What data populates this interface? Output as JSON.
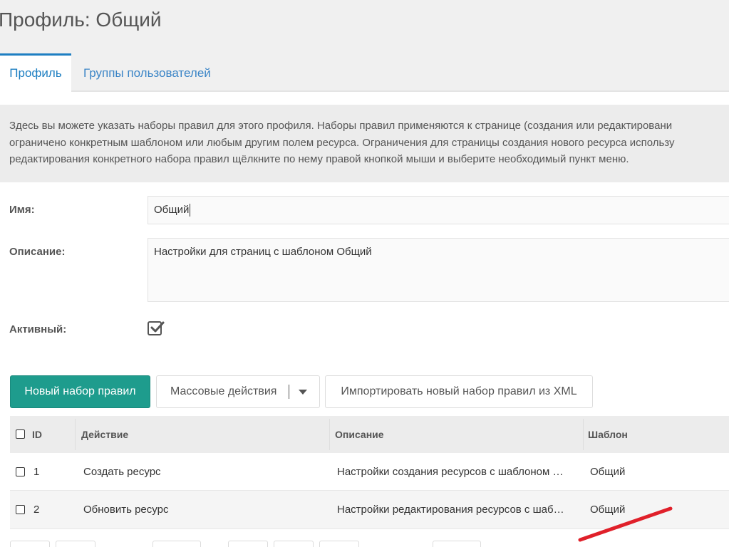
{
  "header": {
    "title": "Профиль: Общий"
  },
  "tabs": [
    {
      "label": "Профиль",
      "active": true
    },
    {
      "label": "Группы пользователей",
      "active": false
    }
  ],
  "info": {
    "lines": [
      "Здесь вы можете указать наборы правил для этого профиля. Наборы правил применяются к странице (создания или редактировани",
      "ограничено конкретным шаблоном или любым другим полем ресурса. Ограничения для страницы создания нового ресурса использу",
      "редактирования конкретного набора правил щёлкните по нему правой кнопкой мыши и выберите необходимый пункт меню."
    ]
  },
  "form": {
    "name_label": "Имя:",
    "name_value": "Общий",
    "description_label": "Описание:",
    "description_value": "Настройки для страниц с шаблоном Общий",
    "active_label": "Активный:",
    "active_checked": true
  },
  "toolbar": {
    "new_ruleset_label": "Новый набор правил",
    "bulk_actions_label": "Массовые действия",
    "import_label": "Импортировать новый набор правил из XML"
  },
  "grid": {
    "columns": [
      "ID",
      "Действие",
      "Описание",
      "Шаблон"
    ],
    "rows": [
      {
        "id": "1",
        "action": "Создать ресурс",
        "description": "Настройки создания ресурсов с шаблоном …",
        "template": "Общий"
      },
      {
        "id": "2",
        "action": "Обновить ресурс",
        "description": "Настройки редактирования ресурсов с шаб…",
        "template": "Общий"
      }
    ]
  },
  "colors": {
    "accent": "#1e7fc2",
    "primary_button": "#1e9c8d",
    "annotation_stroke": "#e0202a"
  }
}
